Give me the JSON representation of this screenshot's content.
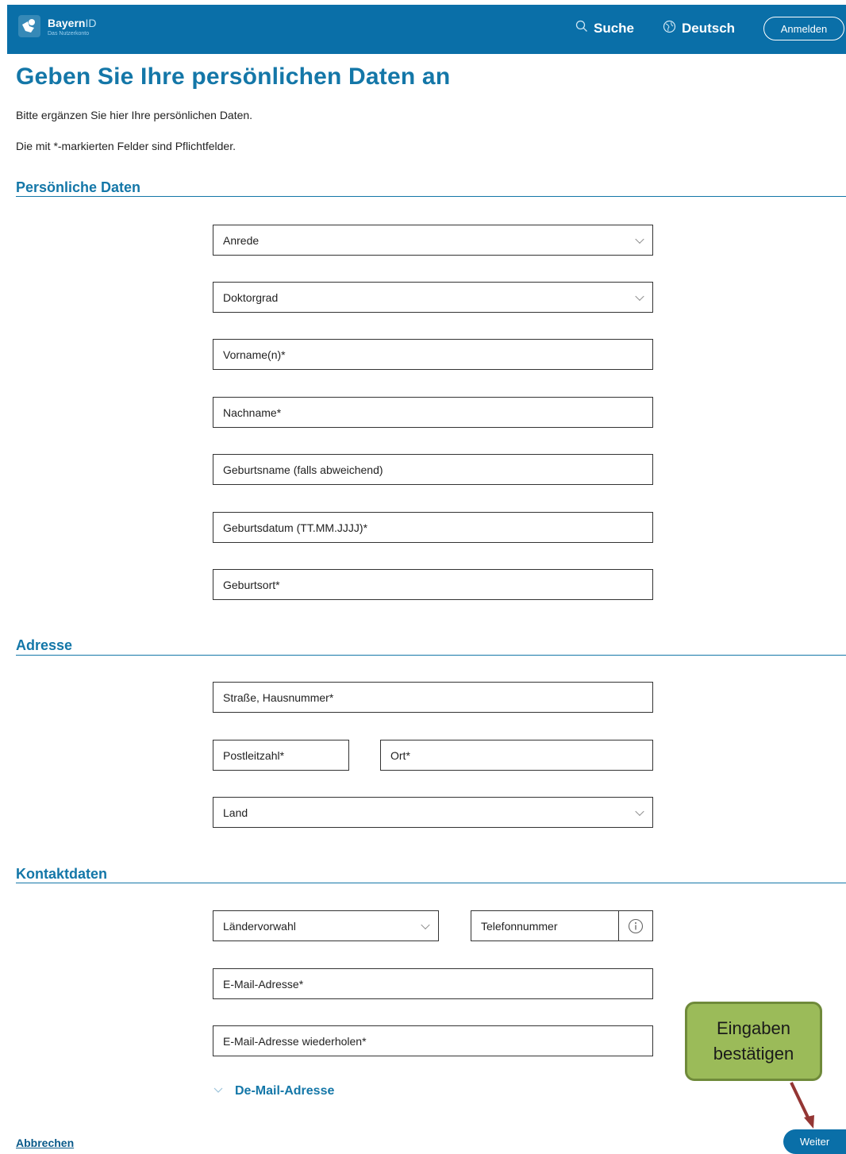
{
  "header": {
    "brand_name": "Bayern",
    "brand_suffix": "ID",
    "brand_sub": "Das Nutzerkonto",
    "search_label": "Suche",
    "language_label": "Deutsch",
    "login_label": "Anmelden"
  },
  "page": {
    "title": "Geben Sie Ihre persönlichen Daten an",
    "intro": "Bitte ergänzen Sie hier Ihre persönlichen Daten.",
    "required_note": "Die mit *-markierten Felder sind Pflichtfelder."
  },
  "sections": {
    "personal": "Persönliche Daten",
    "address": "Adresse",
    "contact": "Kontaktdaten"
  },
  "fields": {
    "salutation": "Anrede",
    "doctoral": "Doktorgrad",
    "first_name": "Vorname(n)*",
    "last_name": "Nachname*",
    "birth_name": "Geburtsname (falls abweichend)",
    "birth_date": "Geburtsdatum (TT.MM.JJJJ)*",
    "birth_place": "Geburtsort*",
    "street": "Straße, Hausnummer*",
    "postal_code": "Postleitzahl*",
    "city": "Ort*",
    "country": "Land",
    "country_code": "Ländervorwahl",
    "phone": "Telefonnummer",
    "email": "E-Mail-Adresse*",
    "email_repeat": "E-Mail-Adresse wiederholen*"
  },
  "demail_label": "De-Mail-Adresse",
  "actions": {
    "cancel": "Abbrechen",
    "next": "Weiter"
  },
  "callout": {
    "line1": "Eingaben",
    "line2": "bestätigen",
    "fill_color": "#9bbb59",
    "arrow_color": "#943634"
  },
  "colors": {
    "brand_blue": "#0a6fa8",
    "heading_blue": "#1477a8"
  },
  "icons": {
    "logo": "bayernid-logo-icon",
    "search": "search-icon",
    "language": "globe-icon",
    "dropdown": "chevron-down-icon",
    "info": "info-icon"
  }
}
